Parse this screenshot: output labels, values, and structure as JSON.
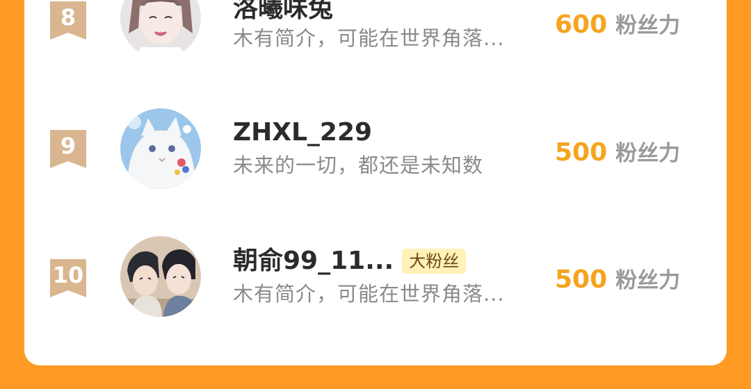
{
  "colors": {
    "background": "#FF9A24",
    "card": "#FFFFFF",
    "rank_badge": "#D9B690",
    "fans_number": "#F5A41E",
    "tag_background": "#FFF1B8"
  },
  "rankings": [
    {
      "rank": "8",
      "name": "洛曦味兔",
      "bio": "木有简介，可能在世界角落...",
      "fans_value": "600",
      "fans_unit": "粉丝力",
      "avatar_icon": "avatar-anime-boy-icon"
    },
    {
      "rank": "9",
      "name": "ZHXL_229",
      "bio": "未来的一切，都还是未知数",
      "fans_value": "500",
      "fans_unit": "粉丝力",
      "avatar_icon": "avatar-white-cat-icon"
    },
    {
      "rank": "10",
      "name": "朝俞99_11...",
      "tag": "大粉丝",
      "bio": "木有简介，可能在世界角落...",
      "fans_value": "500",
      "fans_unit": "粉丝力",
      "avatar_icon": "avatar-two-boys-icon"
    }
  ]
}
